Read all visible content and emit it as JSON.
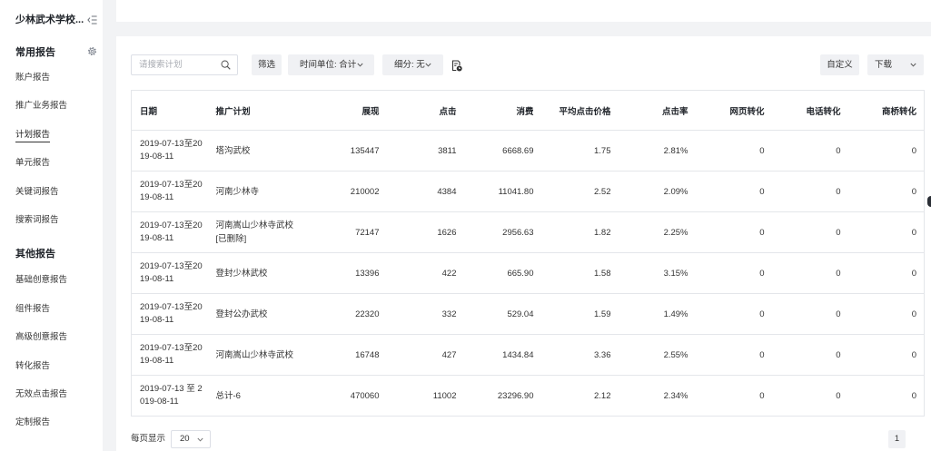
{
  "sidebar": {
    "account_title": "少林武术学校...",
    "sections": [
      {
        "title": "常用报告",
        "items": [
          {
            "label": "账户报告"
          },
          {
            "label": "推广业务报告"
          },
          {
            "label": "计划报告",
            "active": true
          },
          {
            "label": "单元报告"
          },
          {
            "label": "关键词报告"
          },
          {
            "label": "搜索词报告"
          }
        ]
      },
      {
        "title": "其他报告",
        "items": [
          {
            "label": "基础创意报告"
          },
          {
            "label": "组件报告"
          },
          {
            "label": "高级创意报告"
          },
          {
            "label": "转化报告"
          },
          {
            "label": "无效点击报告"
          },
          {
            "label": "定制报告"
          }
        ]
      }
    ]
  },
  "toolbar": {
    "search_placeholder": "请搜索计划",
    "filter_label": "筛选",
    "time_unit_label": "时间单位: 合计",
    "segment_label": "细分: 无",
    "customize_label": "自定义",
    "download_label": "下载"
  },
  "table": {
    "columns": [
      "日期",
      "推广计划",
      "展现",
      "点击",
      "消费",
      "平均点击价格",
      "点击率",
      "网页转化",
      "电话转化",
      "商桥转化"
    ],
    "rows": [
      {
        "date": "2019-07-13至2019-08-11",
        "plan": "塔沟武校",
        "impressions": "135447",
        "clicks": "3811",
        "cost": "6668.69",
        "avg_cpc": "1.75",
        "ctr": "2.81%",
        "web_conversions": "0",
        "phone_conversions": "0",
        "bridge_conversions": "0"
      },
      {
        "date": "2019-07-13至2019-08-11",
        "plan": "河南少林寺",
        "impressions": "210002",
        "clicks": "4384",
        "cost": "11041.80",
        "avg_cpc": "2.52",
        "ctr": "2.09%",
        "web_conversions": "0",
        "phone_conversions": "0",
        "bridge_conversions": "0"
      },
      {
        "date": "2019-07-13至2019-08-11",
        "plan": "河南嵩山少林寺武校",
        "plan_tag": "[已删除]",
        "impressions": "72147",
        "clicks": "1626",
        "cost": "2956.63",
        "avg_cpc": "1.82",
        "ctr": "2.25%",
        "web_conversions": "0",
        "phone_conversions": "0",
        "bridge_conversions": "0"
      },
      {
        "date": "2019-07-13至2019-08-11",
        "plan": "登封少林武校",
        "impressions": "13396",
        "clicks": "422",
        "cost": "665.90",
        "avg_cpc": "1.58",
        "ctr": "3.15%",
        "web_conversions": "0",
        "phone_conversions": "0",
        "bridge_conversions": "0"
      },
      {
        "date": "2019-07-13至2019-08-11",
        "plan": "登封公办武校",
        "impressions": "22320",
        "clicks": "332",
        "cost": "529.04",
        "avg_cpc": "1.59",
        "ctr": "1.49%",
        "web_conversions": "0",
        "phone_conversions": "0",
        "bridge_conversions": "0"
      },
      {
        "date": "2019-07-13至2019-08-11",
        "plan": "河南嵩山少林寺武校",
        "impressions": "16748",
        "clicks": "427",
        "cost": "1434.84",
        "avg_cpc": "3.36",
        "ctr": "2.55%",
        "web_conversions": "0",
        "phone_conversions": "0",
        "bridge_conversions": "0"
      },
      {
        "date": "2019-07-13 至 2019-08-11",
        "plan": "总计-6",
        "impressions": "470060",
        "clicks": "11002",
        "cost": "23296.90",
        "avg_cpc": "2.12",
        "ctr": "2.34%",
        "web_conversions": "0",
        "phone_conversions": "0",
        "bridge_conversions": "0"
      }
    ]
  },
  "footer": {
    "page_size_label": "每页显示",
    "page_size_value": "20",
    "current_page": "1"
  },
  "icons": {
    "sidebar_collapse": "collapse-sidebar-icon",
    "settings": "gear-icon",
    "search": "search-icon",
    "dropdown": "chevron-down-icon",
    "report_tool": "document-clock-icon"
  },
  "colors": {
    "background": "#f2f3f5",
    "panel": "#ffffff",
    "text": "#333333",
    "button_bg": "#f0f1f4",
    "border": "#e4e6ea"
  }
}
